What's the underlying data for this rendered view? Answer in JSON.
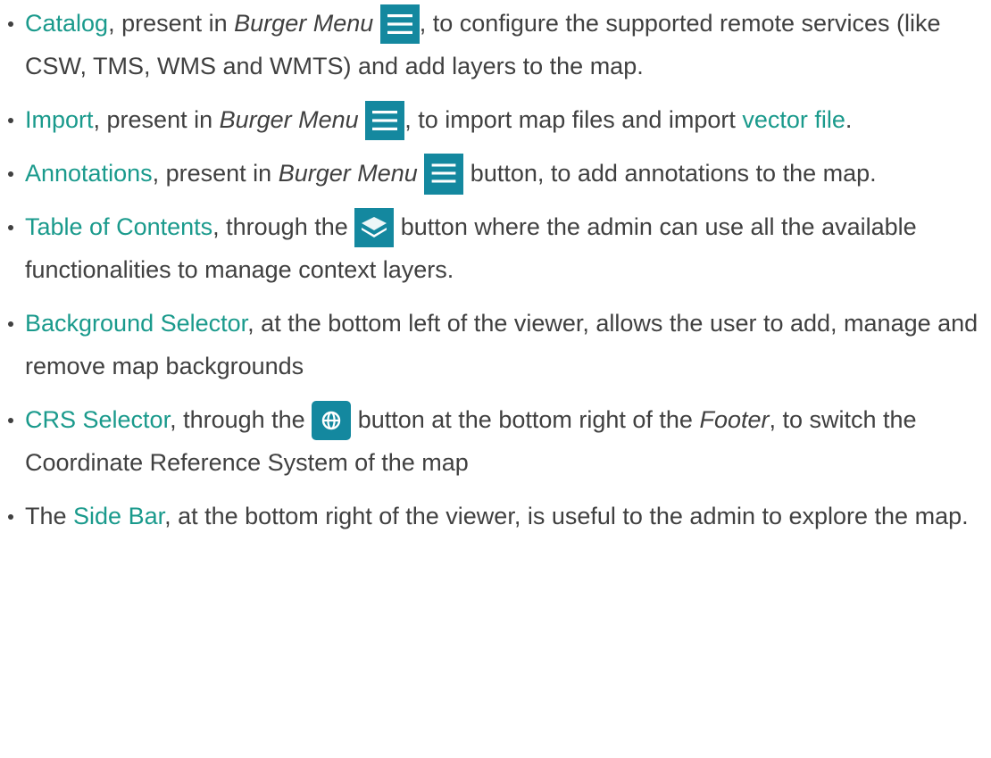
{
  "items": [
    {
      "link": "Catalog",
      "t1": ", present in ",
      "em": "Burger Menu",
      "t2": ", to configure the supported remote services (like CSW, TMS, WMS and WMTS) and add layers to the map.",
      "icon": "burger-menu-icon"
    },
    {
      "link": "Import",
      "t1": ", present in ",
      "em": "Burger Menu",
      "t2": ", to import map files and import ",
      "link2": "vector file",
      "t3": ".",
      "icon": "burger-menu-icon"
    },
    {
      "link": "Annotations",
      "t1": ", present in ",
      "em": "Burger Menu",
      "t2": " button, to add annotations to the map.",
      "icon": "burger-menu-icon"
    },
    {
      "link": "Table of Contents",
      "t1": ", through the ",
      "t2": " button where the admin can use all the available functionalities to manage context layers.",
      "icon": "layers-icon"
    },
    {
      "link": "Background Selector",
      "t1": ", at the bottom left of the viewer, allows the user to add, manage and remove map backgrounds"
    },
    {
      "link": "CRS Selector",
      "t1": ", through the ",
      "t2": " button at the bottom right of the ",
      "em": "Footer",
      "t3": ", to switch the Coordinate Reference System of the map",
      "icon": "globe-icon"
    },
    {
      "pre": "The ",
      "link": "Side Bar",
      "t1": ", at the bottom right of the viewer, is useful to the admin to explore the map."
    }
  ],
  "colors": {
    "link": "#1a9a8c",
    "icon_button_bg": "#14889f",
    "text": "#404040"
  }
}
